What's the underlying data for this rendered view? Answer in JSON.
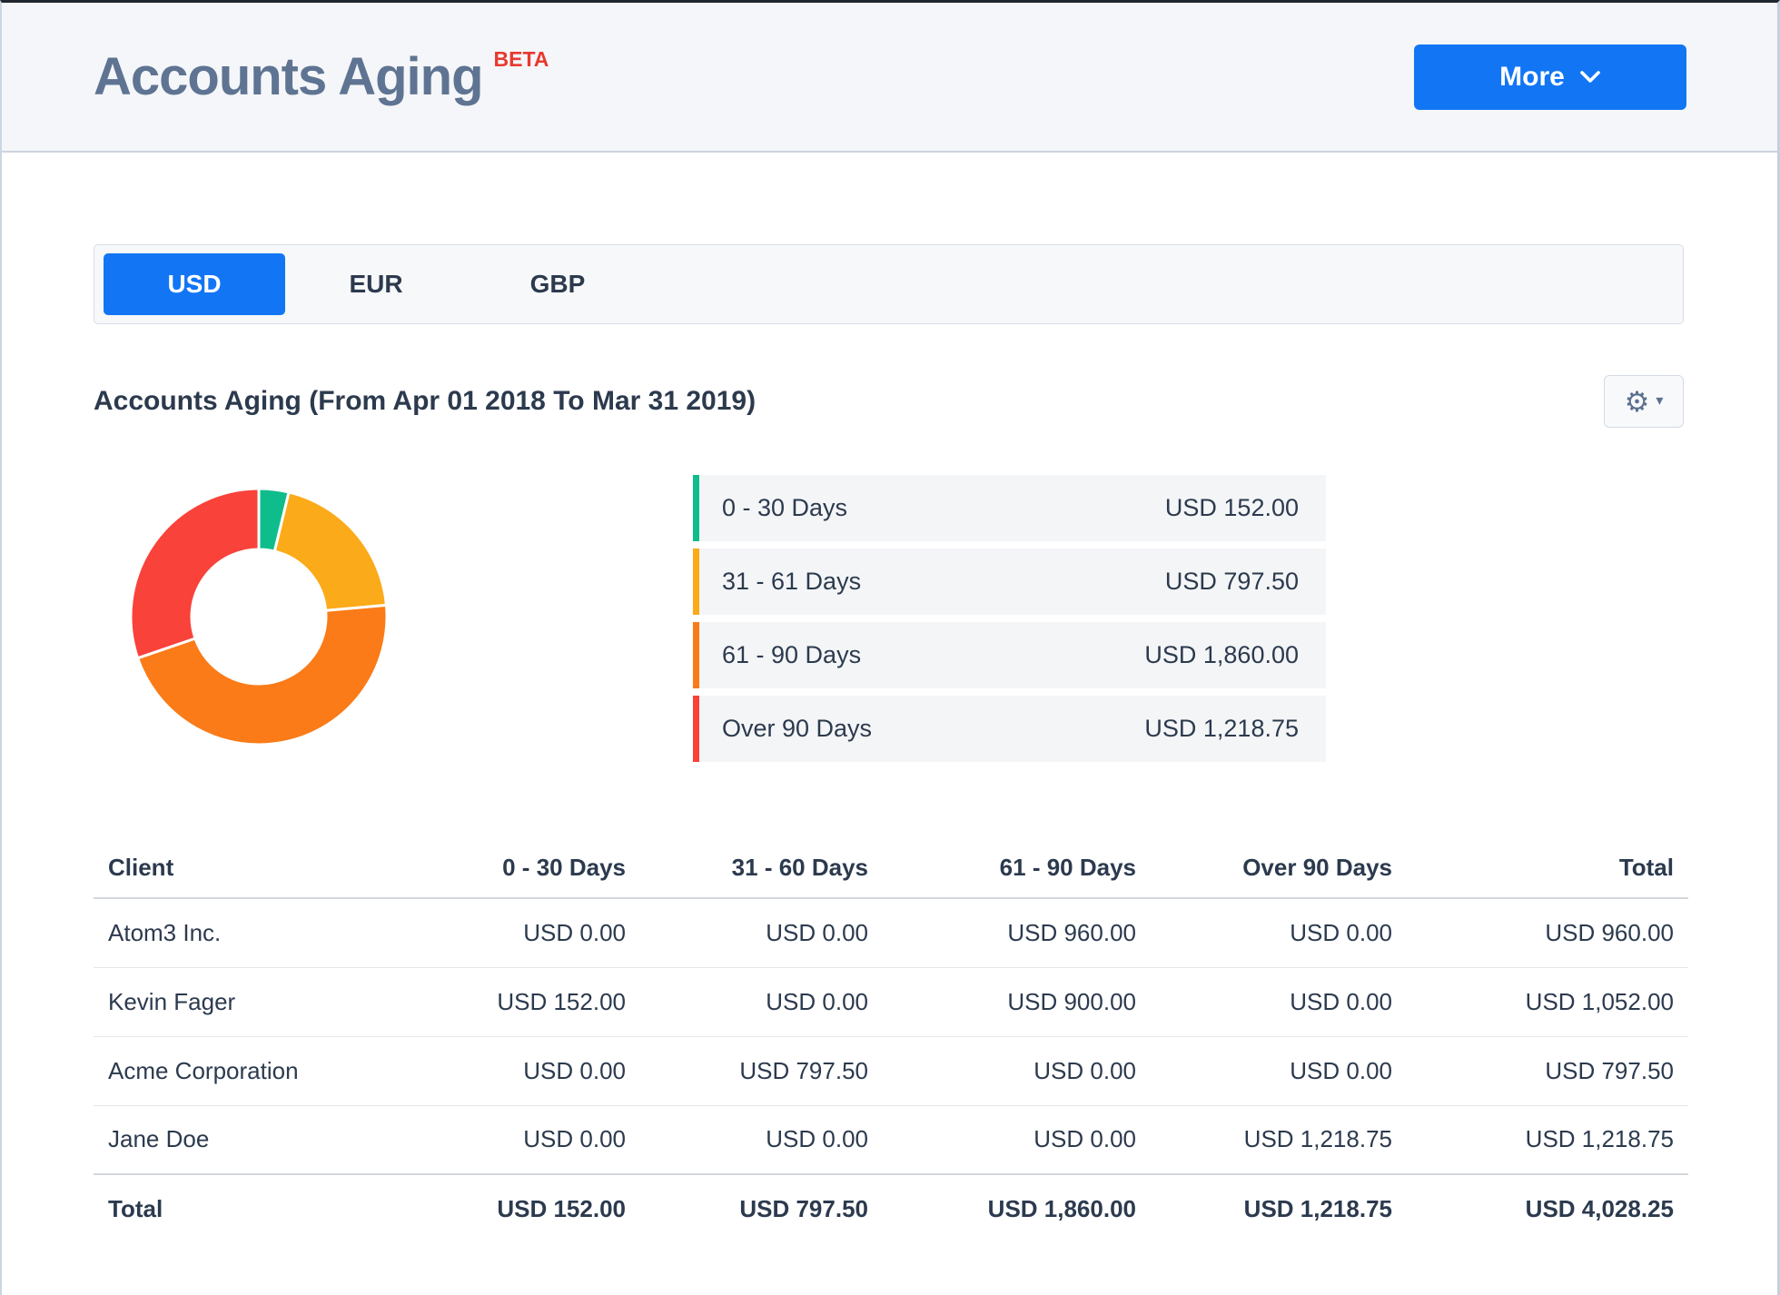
{
  "header": {
    "title": "Accounts Aging",
    "beta_badge": "BETA",
    "more_label": "More"
  },
  "currency_tabs": {
    "items": [
      "USD",
      "EUR",
      "GBP"
    ],
    "active": "USD"
  },
  "report": {
    "section_title": "Accounts Aging (From Apr 01 2018 To Mar 31 2019)",
    "settings_icon": "gear-icon",
    "settings_caret": "▾",
    "gear_glyph": "⚙"
  },
  "chart_data": {
    "type": "pie",
    "style": "donut",
    "title": "Accounts Aging (From Apr 01 2018 To Mar 31 2019)",
    "categories": [
      "0 - 30 Days",
      "31 - 61 Days",
      "61 - 90 Days",
      "Over 90 Days"
    ],
    "values": [
      152.0,
      797.5,
      1860.0,
      1218.75
    ],
    "values_formatted": [
      "USD 152.00",
      "USD 797.50",
      "USD 1,860.00",
      "USD 1,218.75"
    ],
    "colors": [
      "#0fbd8c",
      "#fbaa19",
      "#fa7b17",
      "#f9423a"
    ],
    "total": 4028.25,
    "start_angle_deg": 0,
    "direction": "clockwise",
    "legend_position": "right"
  },
  "table": {
    "columns": [
      "Client",
      "0 - 30 Days",
      "31 - 60 Days",
      "61 - 90 Days",
      "Over 90 Days",
      "Total"
    ],
    "rows": [
      [
        "Atom3 Inc.",
        "USD 0.00",
        "USD 0.00",
        "USD 960.00",
        "USD 0.00",
        "USD 960.00"
      ],
      [
        "Kevin Fager",
        "USD 152.00",
        "USD 0.00",
        "USD 900.00",
        "USD 0.00",
        "USD 1,052.00"
      ],
      [
        "Acme Corporation",
        "USD 0.00",
        "USD 797.50",
        "USD 0.00",
        "USD 0.00",
        "USD 797.50"
      ],
      [
        "Jane Doe",
        "USD 0.00",
        "USD 0.00",
        "USD 0.00",
        "USD 1,218.75",
        "USD 1,218.75"
      ]
    ],
    "total_row": [
      "Total",
      "USD 152.00",
      "USD 797.50",
      "USD 1,860.00",
      "USD 1,218.75",
      "USD 4,028.25"
    ]
  },
  "colors": {
    "accent_blue": "#1276f4",
    "title_slate": "#5e7492",
    "beta_red": "#e8392f",
    "text_dark": "#2c3a4e",
    "header_bg": "#f5f6f9",
    "legend_row_bg": "#f4f5f7"
  }
}
